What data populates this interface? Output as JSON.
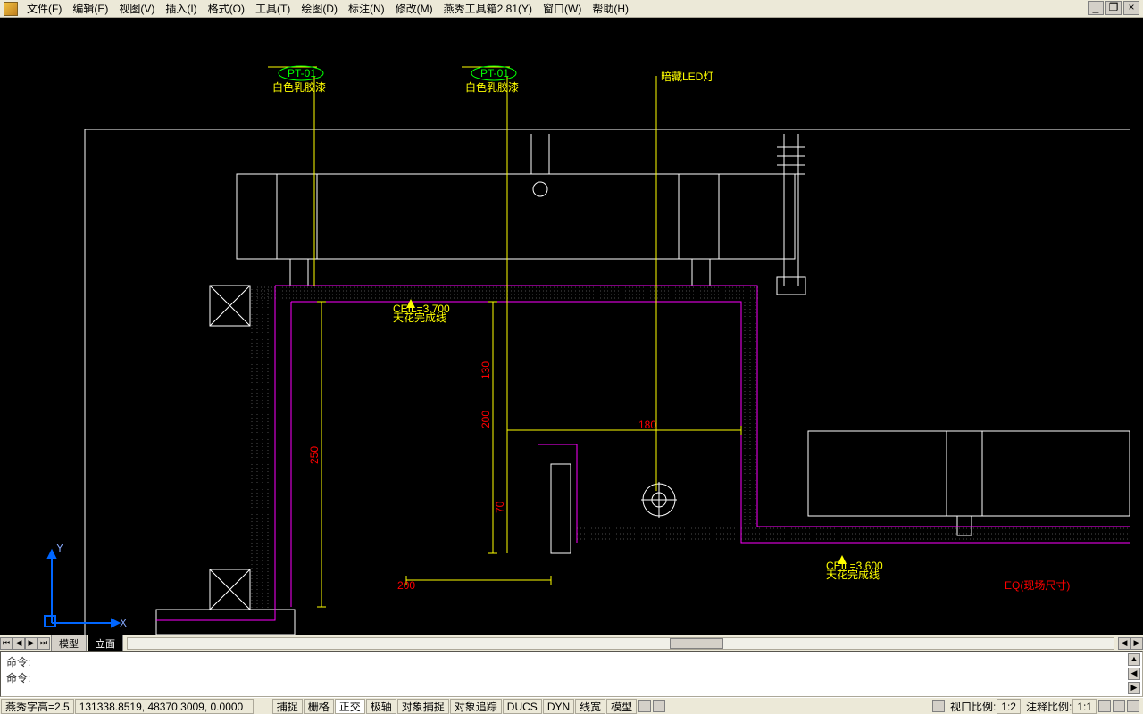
{
  "menu": {
    "items": [
      "文件(F)",
      "编辑(E)",
      "视图(V)",
      "插入(I)",
      "格式(O)",
      "工具(T)",
      "绘图(D)",
      "标注(N)",
      "修改(M)",
      "燕秀工具箱2.81(Y)",
      "窗口(W)",
      "帮助(H)"
    ]
  },
  "tabs": {
    "model": "模型",
    "layout": "立面"
  },
  "cmd": {
    "l1": "命令:",
    "l2": "命令:"
  },
  "status": {
    "th": "燕秀字高=2.5",
    "coords": "131338.8519, 48370.3009, 0.0000",
    "btns": [
      "捕捉",
      "栅格",
      "正交",
      "极轴",
      "对象捕捉",
      "对象追踪",
      "DUCS",
      "DYN",
      "线宽",
      "模型"
    ],
    "vp": "视口比例:",
    "vpr": "1:2",
    "ann": "注释比例:",
    "annr": "1:1"
  },
  "labels": {
    "pt01": "PT-01",
    "paint": "白色乳胶漆",
    "led": "暗藏LED灯",
    "ceil1": "CEIL=3.700",
    "ceil1b": "天花完成线",
    "ceil2": "CEIL=3.600",
    "ceil2b": "天花完成线",
    "eq": "EQ(现场尺寸)"
  },
  "dims": {
    "d250": "250",
    "d200v": "200",
    "d130": "130",
    "d70": "70",
    "d180": "180",
    "d200h": "200"
  }
}
